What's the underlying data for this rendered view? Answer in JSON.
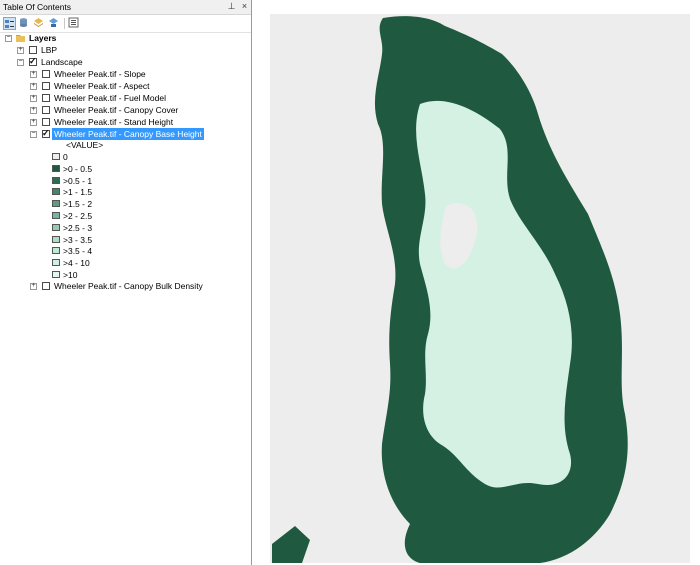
{
  "toc": {
    "title": "Table Of Contents",
    "pin_icon": "pin-icon",
    "close_icon": "close-icon",
    "root": {
      "label": "Layers"
    },
    "layers": [
      {
        "label": "LBP",
        "checked": false,
        "expanded": false
      },
      {
        "label": "Landscape",
        "checked": true,
        "expanded": true
      }
    ],
    "sublayers": [
      {
        "label": "Wheeler Peak.tif - Slope",
        "checked": false
      },
      {
        "label": "Wheeler Peak.tif - Aspect",
        "checked": false
      },
      {
        "label": "Wheeler Peak.tif - Fuel Model",
        "checked": false
      },
      {
        "label": "Wheeler Peak.tif - Canopy Cover",
        "checked": false
      },
      {
        "label": "Wheeler Peak.tif - Stand Height",
        "checked": false
      },
      {
        "label": "Wheeler Peak.tif - Canopy Base Height",
        "checked": true,
        "selected": true
      }
    ],
    "legend": {
      "field": "<VALUE>",
      "classes": [
        {
          "label": "0",
          "color": "#eeeeee"
        },
        {
          "label": ">0 - 0.5",
          "color": "#1f5a40"
        },
        {
          "label": ">0.5 - 1",
          "color": "#2d6e51"
        },
        {
          "label": ">1 - 1.5",
          "color": "#45866a"
        },
        {
          "label": ">1.5 - 2",
          "color": "#5e9d82"
        },
        {
          "label": ">2 - 2.5",
          "color": "#7ab49a"
        },
        {
          "label": ">2.5 - 3",
          "color": "#96cab2"
        },
        {
          "label": ">3 - 3.5",
          "color": "#afdcc7"
        },
        {
          "label": ">3.5 - 4",
          "color": "#c2e8d6"
        },
        {
          "label": ">4 - 10",
          "color": "#d2f0e2"
        },
        {
          "label": ">10",
          "color": "#e2f7ee"
        }
      ]
    },
    "last_sublayer": {
      "label": "Wheeler Peak.tif - Canopy Bulk Density",
      "checked": false
    }
  },
  "map": {
    "background_color": "#ededed",
    "forest_color": "#1f5a40",
    "open_color": "#d4f1e4"
  }
}
